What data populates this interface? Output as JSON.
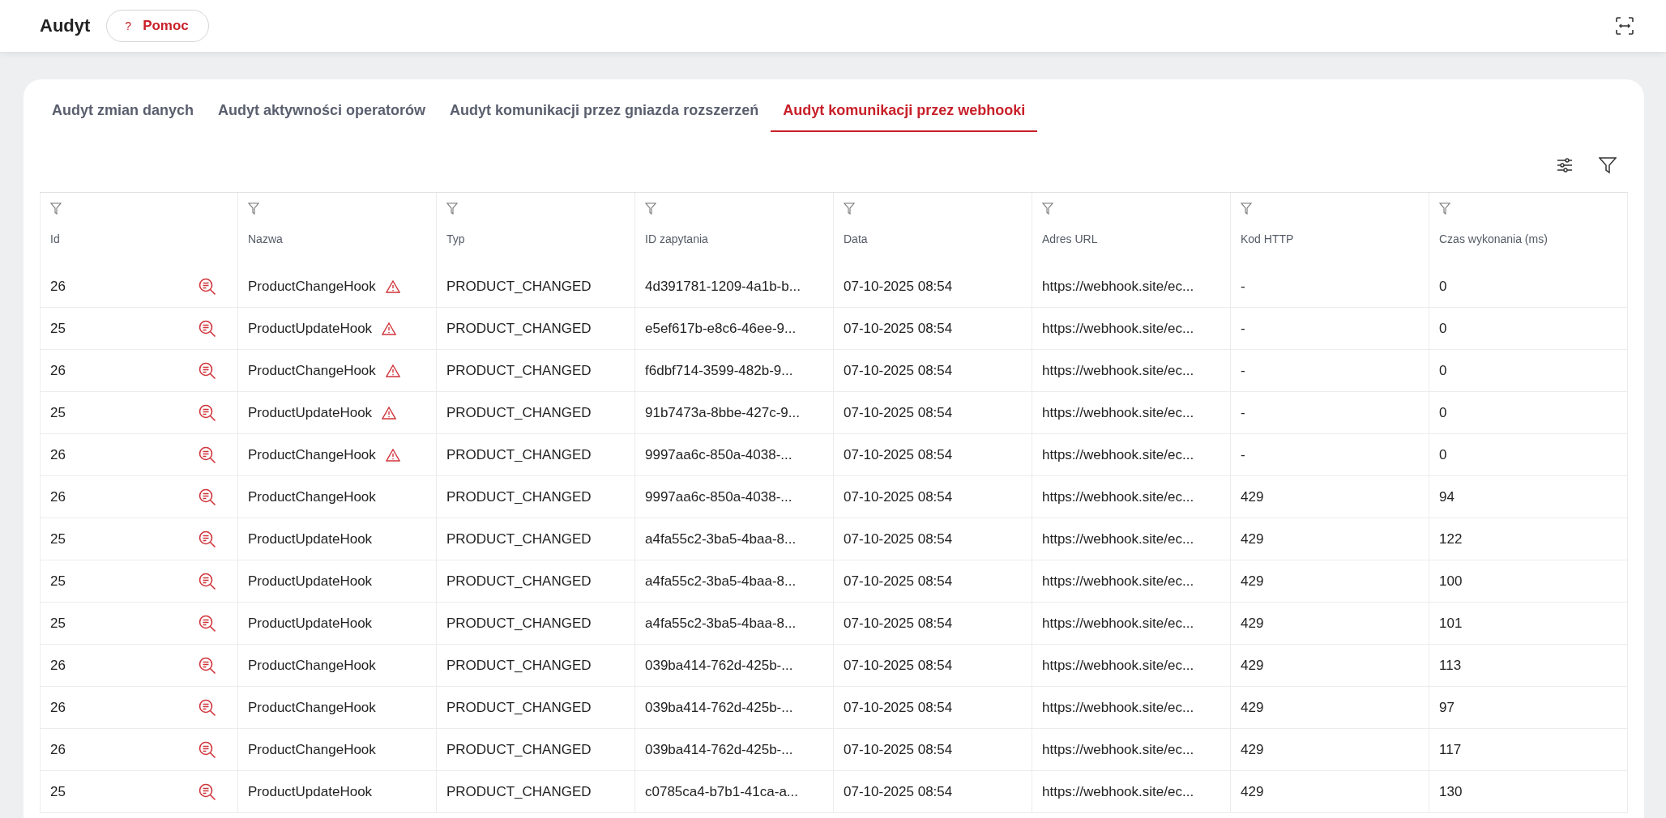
{
  "header": {
    "title": "Audyt",
    "help_button": {
      "label": "Pomoc",
      "icon": "?"
    }
  },
  "tabs": [
    {
      "label": "Audyt zmian danych",
      "selected": false
    },
    {
      "label": "Audyt aktywności operatorów",
      "selected": false
    },
    {
      "label": "Audyt komunikacji przez gniazda rozszerzeń",
      "selected": false
    },
    {
      "label": "Audyt komunikacji przez webhooki",
      "selected": true
    }
  ],
  "table": {
    "columns": [
      "Id",
      "Nazwa",
      "Typ",
      "ID zapytania",
      "Data",
      "Adres URL",
      "Kod HTTP",
      "Czas wykonania (ms)"
    ],
    "rows": [
      {
        "id": "26",
        "name": "ProductChangeHook",
        "warning": true,
        "type": "PRODUCT_CHANGED",
        "request_id": "4d391781-1209-4a1b-b...",
        "date": "07-10-2025 08:54",
        "url": "https://webhook.site/ec...",
        "http_code": "-",
        "duration": "0"
      },
      {
        "id": "25",
        "name": "ProductUpdateHook",
        "warning": true,
        "type": "PRODUCT_CHANGED",
        "request_id": "e5ef617b-e8c6-46ee-9...",
        "date": "07-10-2025 08:54",
        "url": "https://webhook.site/ec...",
        "http_code": "-",
        "duration": "0"
      },
      {
        "id": "26",
        "name": "ProductChangeHook",
        "warning": true,
        "type": "PRODUCT_CHANGED",
        "request_id": "f6dbf714-3599-482b-9...",
        "date": "07-10-2025 08:54",
        "url": "https://webhook.site/ec...",
        "http_code": "-",
        "duration": "0"
      },
      {
        "id": "25",
        "name": "ProductUpdateHook",
        "warning": true,
        "type": "PRODUCT_CHANGED",
        "request_id": "91b7473a-8bbe-427c-9...",
        "date": "07-10-2025 08:54",
        "url": "https://webhook.site/ec...",
        "http_code": "-",
        "duration": "0"
      },
      {
        "id": "26",
        "name": "ProductChangeHook",
        "warning": true,
        "type": "PRODUCT_CHANGED",
        "request_id": "9997aa6c-850a-4038-...",
        "date": "07-10-2025 08:54",
        "url": "https://webhook.site/ec...",
        "http_code": "-",
        "duration": "0"
      },
      {
        "id": "26",
        "name": "ProductChangeHook",
        "warning": false,
        "type": "PRODUCT_CHANGED",
        "request_id": "9997aa6c-850a-4038-...",
        "date": "07-10-2025 08:54",
        "url": "https://webhook.site/ec...",
        "http_code": "429",
        "duration": "94"
      },
      {
        "id": "25",
        "name": "ProductUpdateHook",
        "warning": false,
        "type": "PRODUCT_CHANGED",
        "request_id": "a4fa55c2-3ba5-4baa-8...",
        "date": "07-10-2025 08:54",
        "url": "https://webhook.site/ec...",
        "http_code": "429",
        "duration": "122"
      },
      {
        "id": "25",
        "name": "ProductUpdateHook",
        "warning": false,
        "type": "PRODUCT_CHANGED",
        "request_id": "a4fa55c2-3ba5-4baa-8...",
        "date": "07-10-2025 08:54",
        "url": "https://webhook.site/ec...",
        "http_code": "429",
        "duration": "100"
      },
      {
        "id": "25",
        "name": "ProductUpdateHook",
        "warning": false,
        "type": "PRODUCT_CHANGED",
        "request_id": "a4fa55c2-3ba5-4baa-8...",
        "date": "07-10-2025 08:54",
        "url": "https://webhook.site/ec...",
        "http_code": "429",
        "duration": "101"
      },
      {
        "id": "26",
        "name": "ProductChangeHook",
        "warning": false,
        "type": "PRODUCT_CHANGED",
        "request_id": "039ba414-762d-425b-...",
        "date": "07-10-2025 08:54",
        "url": "https://webhook.site/ec...",
        "http_code": "429",
        "duration": "113"
      },
      {
        "id": "26",
        "name": "ProductChangeHook",
        "warning": false,
        "type": "PRODUCT_CHANGED",
        "request_id": "039ba414-762d-425b-...",
        "date": "07-10-2025 08:54",
        "url": "https://webhook.site/ec...",
        "http_code": "429",
        "duration": "97"
      },
      {
        "id": "26",
        "name": "ProductChangeHook",
        "warning": false,
        "type": "PRODUCT_CHANGED",
        "request_id": "039ba414-762d-425b-...",
        "date": "07-10-2025 08:54",
        "url": "https://webhook.site/ec...",
        "http_code": "429",
        "duration": "117"
      },
      {
        "id": "25",
        "name": "ProductUpdateHook",
        "warning": false,
        "type": "PRODUCT_CHANGED",
        "request_id": "c0785ca4-b7b1-41ca-a...",
        "date": "07-10-2025 08:54",
        "url": "https://webhook.site/ec...",
        "http_code": "429",
        "duration": "130"
      }
    ]
  }
}
